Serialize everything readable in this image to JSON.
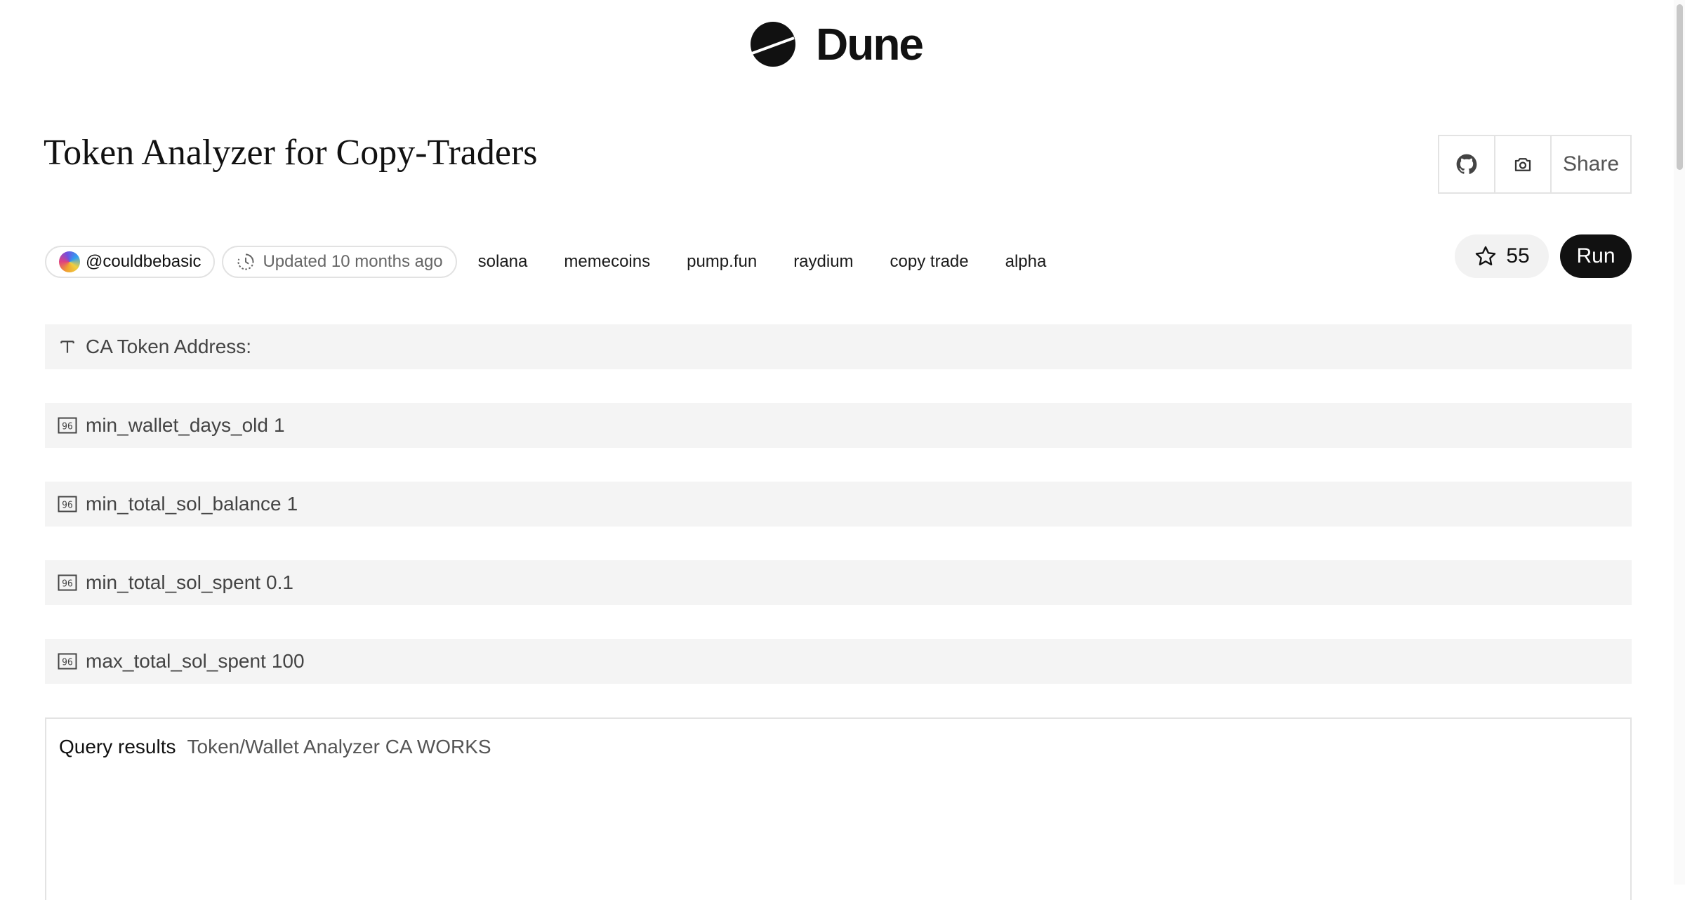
{
  "brand": {
    "name": "Dune"
  },
  "dashboard": {
    "title": "Token Analyzer for Copy-Traders",
    "author": "@couldbebasic",
    "updated": "Updated 10 months ago",
    "tags": [
      "solana",
      "memecoins",
      "pump.fun",
      "raydium",
      "copy trade",
      "alpha"
    ],
    "stars": "55"
  },
  "actions": {
    "share_label": "Share",
    "run_label": "Run"
  },
  "params": [
    {
      "label": "CA Token Address:",
      "value": "",
      "icon": "text-icon"
    },
    {
      "label": "min_wallet_days_old",
      "value": "1",
      "icon": "number-icon"
    },
    {
      "label": "min_total_sol_balance",
      "value": "1",
      "icon": "number-icon"
    },
    {
      "label": "min_total_sol_spent",
      "value": "0.1",
      "icon": "number-icon"
    },
    {
      "label": "max_total_sol_spent",
      "value": "100",
      "icon": "number-icon"
    }
  ],
  "results": {
    "label": "Query results",
    "query_name": "Token/Wallet Analyzer CA WORKS"
  }
}
